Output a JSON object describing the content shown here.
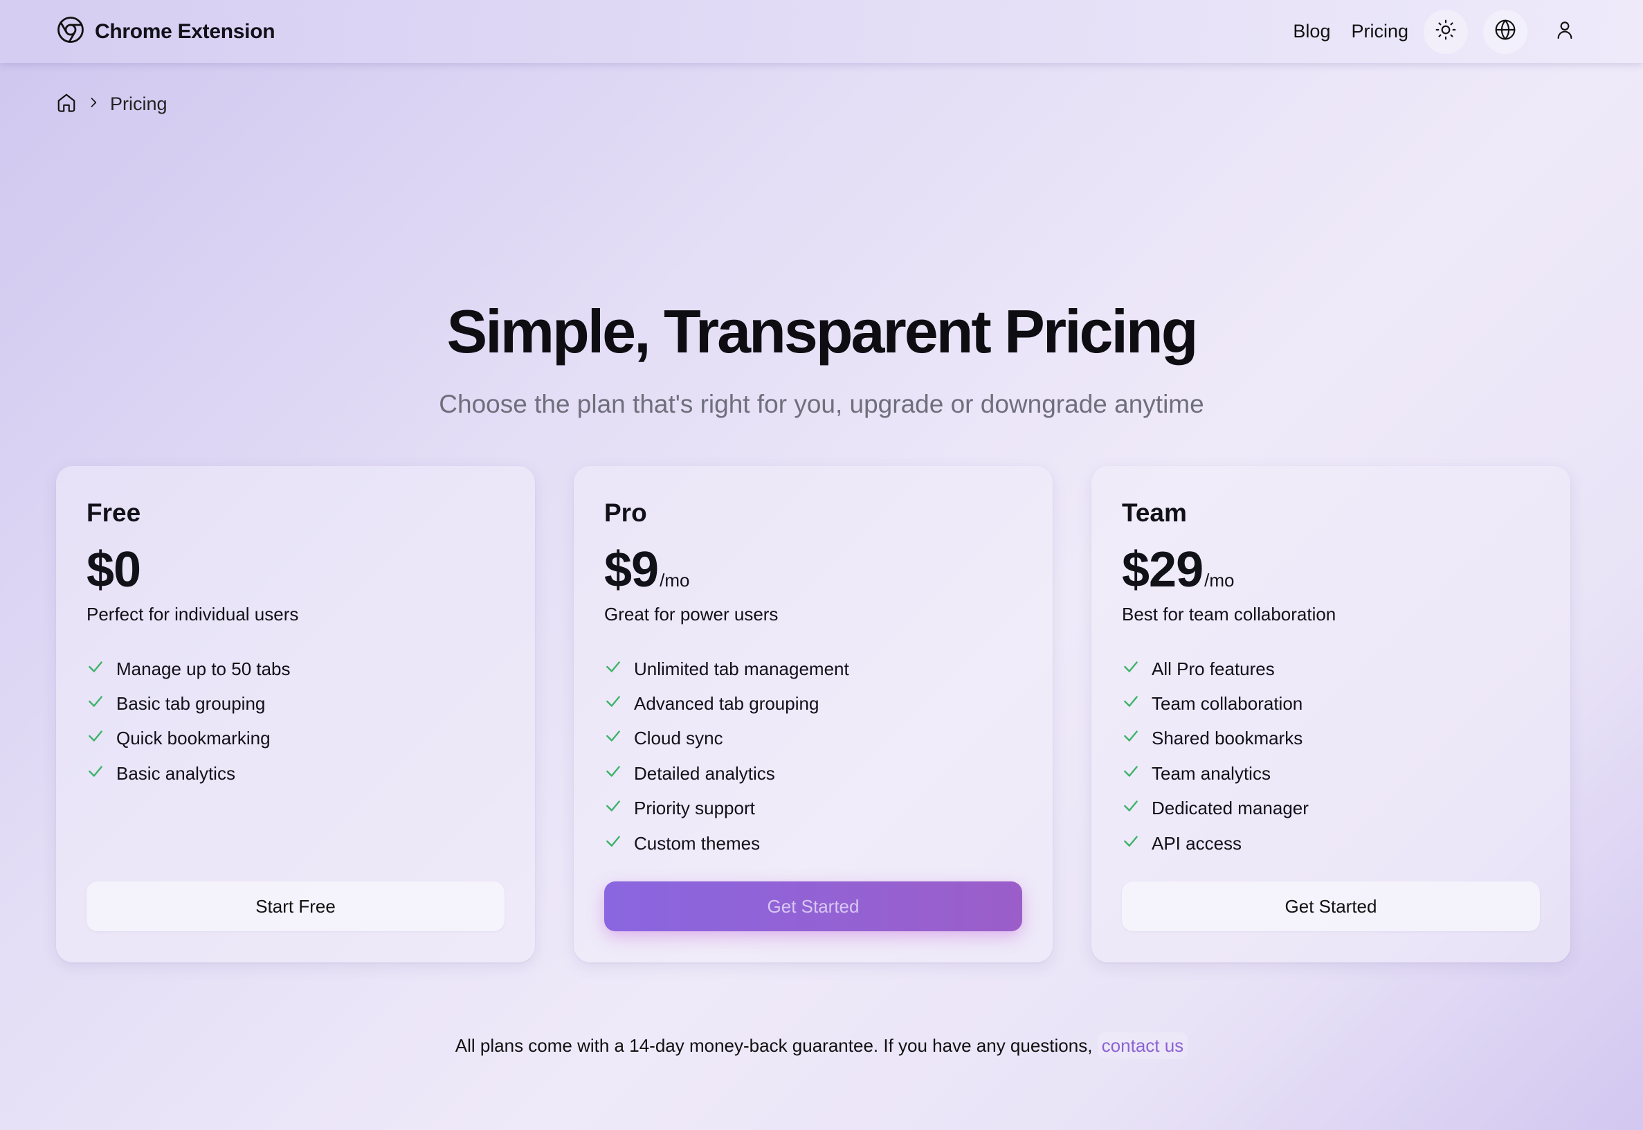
{
  "header": {
    "brand_name": "Chrome Extension",
    "brand_icon": "chrome-logo-icon",
    "nav": {
      "blog": "Blog",
      "pricing": "Pricing"
    },
    "icons": [
      "sun-icon",
      "globe-icon",
      "user-icon"
    ]
  },
  "breadcrumb": {
    "home_icon": "home-icon",
    "separator_icon": "chevron-right-icon",
    "current": "Pricing"
  },
  "hero": {
    "title": "Simple, Transparent Pricing",
    "subtitle": "Choose the plan that's right for you, upgrade or downgrade anytime"
  },
  "plans": [
    {
      "name": "Free",
      "price": "$0",
      "period": "",
      "description": "Perfect for individual users",
      "features": [
        "Manage up to 50 tabs",
        "Basic tab grouping",
        "Quick bookmarking",
        "Basic analytics"
      ],
      "cta": "Start Free"
    },
    {
      "name": "Pro",
      "price": "$9",
      "period": "/mo",
      "description": "Great for power users",
      "features": [
        "Unlimited tab management",
        "Advanced tab grouping",
        "Cloud sync",
        "Detailed analytics",
        "Priority support",
        "Custom themes"
      ],
      "cta": "Get Started"
    },
    {
      "name": "Team",
      "price": "$29",
      "period": "/mo",
      "description": "Best for team collaboration",
      "features": [
        "All Pro features",
        "Team collaboration",
        "Shared bookmarks",
        "Team analytics",
        "Dedicated manager",
        "API access"
      ],
      "cta": "Get Started"
    }
  ],
  "footer": {
    "guarantee": "All plans come with a 14-day money-back guarantee. If you have any questions, ",
    "contact_link": "contact us"
  },
  "colors": {
    "check": "#3db36a",
    "accent": "#8a63d2",
    "primary_button": "#8a66e0"
  }
}
